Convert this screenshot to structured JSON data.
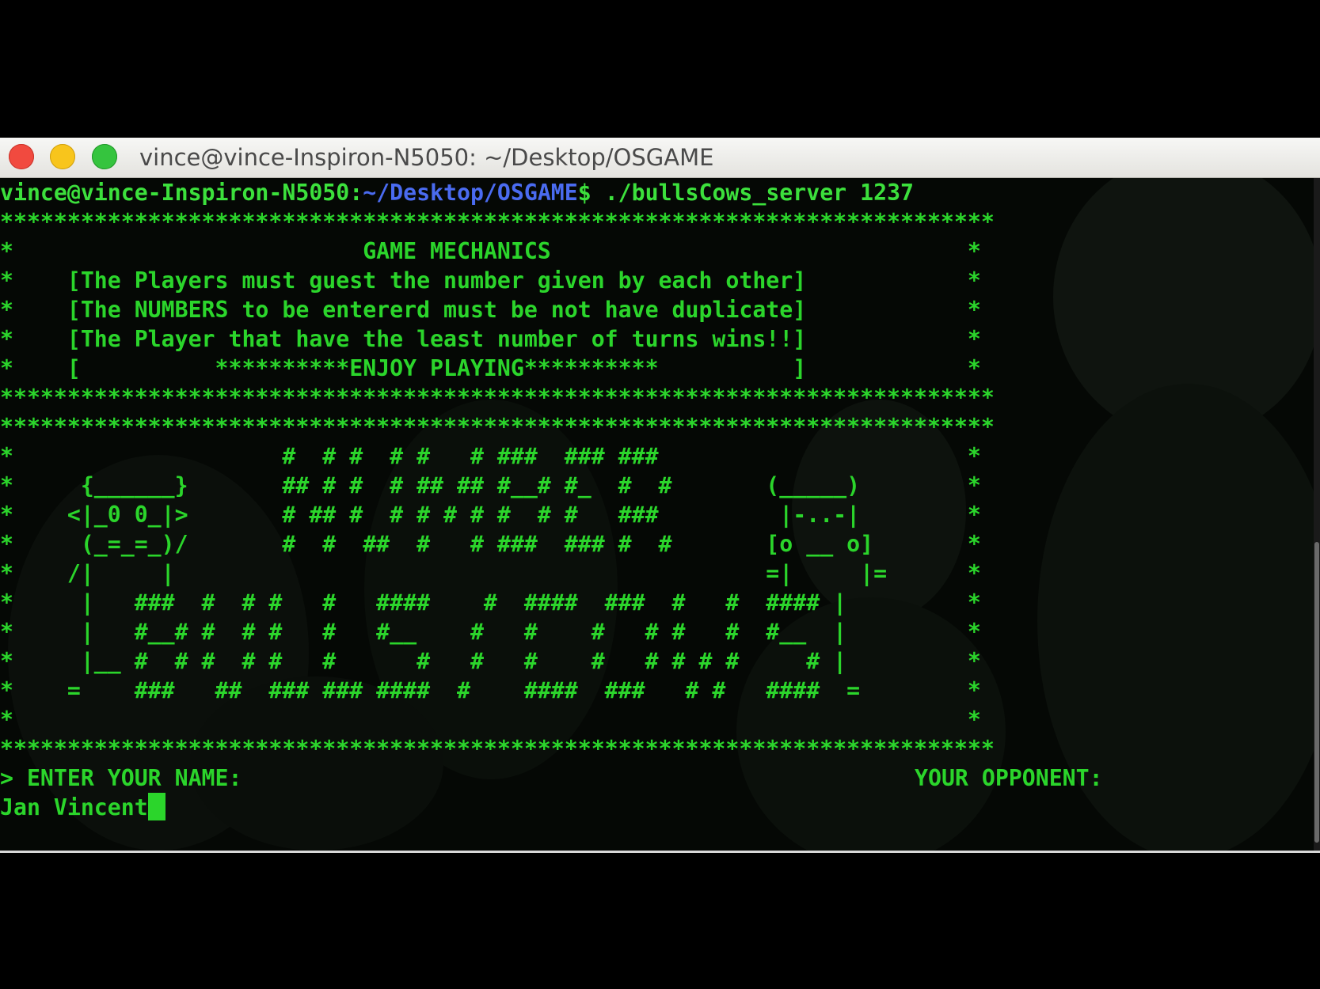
{
  "window": {
    "title": "vince@vince-Inspiron-N5050: ~/Desktop/OSGAME"
  },
  "terminal": {
    "prompt": {
      "user_host": "vince@vince-Inspiron-N5050:",
      "path": "~/Desktop/OSGAME",
      "symbol": "$ ",
      "command": "./bullsCows_server 1237"
    },
    "banner": [
      "**************************************************************************",
      "*                          GAME MECHANICS                               *",
      "*    [The Players must guest the number given by each other]            *",
      "*    [The NUMBERS to be entererd must be not have duplicate]            *",
      "*    [The Player that have the least number of turns wins!!]            *",
      "*    [          **********ENJOY PLAYING**********          ]            *",
      "**************************************************************************",
      "**************************************************************************",
      "*                    #  # #  # #   # ###  ### ###                       *",
      "*     {______}       ## # #  # ## ## #__# #_  #  #       (_____)        *",
      "*    <|_0 0_|>       # ## #  # # # # #  # #   ###         |-..-|        *",
      "*     (_=_=_)/       #  #  ##  #   # ###  ### #  #       [o __ o]       *",
      "*    /|     |                                            =|     |=      *",
      "*     |   ###  #  # #   #   ####    #  ####  ###  #   #  #### |         *",
      "*     |   #__# #  # #   #   #__    #   #    #   # #   #  #__  |         *",
      "*     |__ #  # #  # #   #      #   #   #    #   # # # #     # |         *",
      "*    =    ###   ##  ### ### ####  #    ####  ###   # #   ####  =        *",
      "*                                                                       *",
      "**************************************************************************"
    ],
    "name_prompt": "> ENTER YOUR NAME:",
    "opponent_label": "YOUR OPPONENT:",
    "name_input": "Jan Vincent"
  }
}
